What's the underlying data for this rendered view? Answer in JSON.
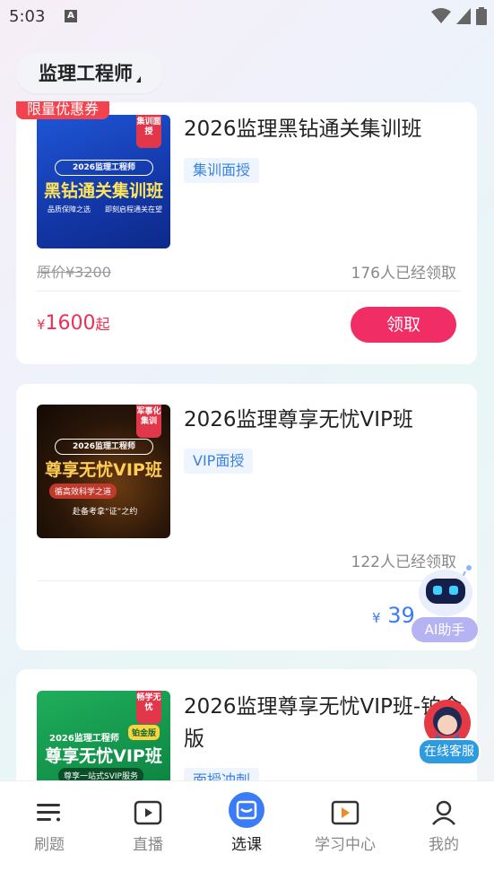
{
  "status_bar": {
    "time": "5:03",
    "badge": "A"
  },
  "header": {
    "category": "监理工程师"
  },
  "promo_ribbon": "限量优惠券",
  "courses": [
    {
      "title": "2026监理黑钻通关集训班",
      "tag": "集训面授",
      "original_price": "原价¥3200",
      "claimed": "176人已经领取",
      "price_symbol": "¥",
      "price": "1600",
      "price_suffix": "起",
      "button": "领取",
      "thumb": {
        "corner": "集训面授",
        "pill": "2026监理工程师",
        "headline": "黑钻通关集训班",
        "sub_left": "品质保障之选",
        "sub_right": "即刻启程通关在望"
      }
    },
    {
      "title": "2026监理尊享无忧VIP班",
      "tag": "VIP面授",
      "claimed": "122人已经领取",
      "price_symbol": "¥",
      "price": "39",
      "thumb": {
        "corner": "军事化集训",
        "pill": "2026监理工程师",
        "headline": "尊享无忧VIP班",
        "sub_left": "循高效科学之道",
        "sub_right": "赴备考拿“证”之约"
      }
    },
    {
      "title": "2026监理尊享无忧VIP班-铂金版",
      "tag": "面授冲刺",
      "thumb": {
        "corner": "畅学无忧",
        "pill": "2026监理工程师",
        "badge": "铂金版",
        "headline": "尊享无忧VIP班",
        "sub": "尊享一站式SVIP服务"
      }
    }
  ],
  "floating": {
    "ai_label": "AI助手",
    "cs_label": "在线客服"
  },
  "nav": [
    {
      "label": "刷题",
      "icon": "list-icon"
    },
    {
      "label": "直播",
      "icon": "play-icon"
    },
    {
      "label": "选课",
      "icon": "bag-icon"
    },
    {
      "label": "学习中心",
      "icon": "study-icon"
    },
    {
      "label": "我的",
      "icon": "user-icon"
    }
  ],
  "colors": {
    "accent_pink": "#f12d66",
    "price_red": "#ee2f55",
    "tag_blue": "#3a82e0",
    "nav_active": "#3a7cf6"
  }
}
